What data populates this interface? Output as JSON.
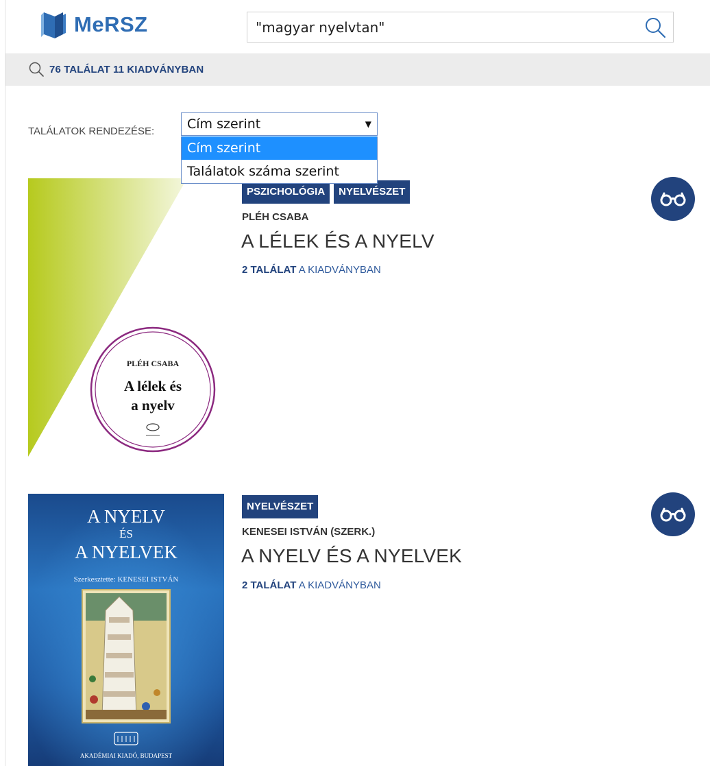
{
  "header": {
    "logo_text": "MeRSZ",
    "search_value": "\"magyar nyelvtan\""
  },
  "results_summary": "76 TALÁLAT 11 KIADVÁNYBAN",
  "sort": {
    "label": "TALÁLATOK RENDEZÉSE:",
    "selected": "Cím szerint",
    "options": [
      "Cím szerint",
      "Találatok száma szerint"
    ]
  },
  "results": [
    {
      "tags": [
        "PSZICHOLÓGIA",
        "NYELVÉSZET"
      ],
      "author": "PLÉH CSABA",
      "title": "A LÉLEK ÉS A NYELV",
      "hits_count": "2 TALÁLAT",
      "hits_suffix": " A KIADVÁNYBAN",
      "cover": {
        "author": "PLÉH CSABA",
        "title_line1": "A lélek és",
        "title_line2": "a nyelv"
      }
    },
    {
      "tags": [
        "NYELVÉSZET"
      ],
      "author": "KENESEI ISTVÁN (SZERK.)",
      "title": "A NYELV ÉS A NYELVEK",
      "hits_count": "2 TALÁLAT",
      "hits_suffix": " A KIADVÁNYBAN",
      "cover": {
        "title_line1": "A NYELV",
        "title_line2": "ÉS",
        "title_line3": "A NYELVEK",
        "editor": "Szerkesztette: KENESEI ISTVÁN",
        "publisher": "AKADÉMIAI KIADÓ, BUDAPEST"
      }
    }
  ],
  "colors": {
    "brand_blue": "#2f6db4",
    "dark_navy": "#22437d",
    "selected_option": "#1e90ff",
    "cover_green": "#b8cc22"
  },
  "icons": {
    "logo": "book-logo-icon",
    "search": "search-icon",
    "read": "glasses-icon"
  }
}
